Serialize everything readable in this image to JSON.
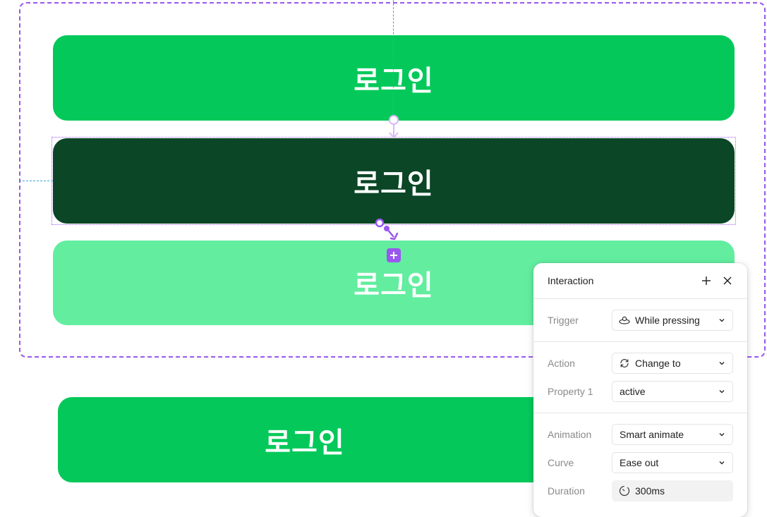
{
  "canvas": {
    "variants": [
      {
        "label": "로그인",
        "state": "default",
        "color": "#04c95a"
      },
      {
        "label": "로그인",
        "state": "pressed",
        "color": "#0b4626"
      },
      {
        "label": "로그인",
        "state": "disabled",
        "color": "#62ed9f"
      }
    ],
    "standalone_button": {
      "label": "로그인",
      "color": "#04c95a"
    },
    "accent_color": "#9a57ee",
    "guide_color": "#3da2e0"
  },
  "interaction_panel": {
    "title": "Interaction",
    "add_icon": "plus-icon",
    "close_icon": "close-icon",
    "trigger": {
      "label": "Trigger",
      "value": "While pressing",
      "icon": "press-icon"
    },
    "action": {
      "label": "Action",
      "value": "Change to",
      "icon": "refresh-icon"
    },
    "property": {
      "label": "Property 1",
      "value": "active"
    },
    "animation": {
      "label": "Animation",
      "value": "Smart animate"
    },
    "curve": {
      "label": "Curve",
      "value": "Ease out"
    },
    "duration": {
      "label": "Duration",
      "value": "300ms",
      "icon": "timer-icon"
    }
  }
}
